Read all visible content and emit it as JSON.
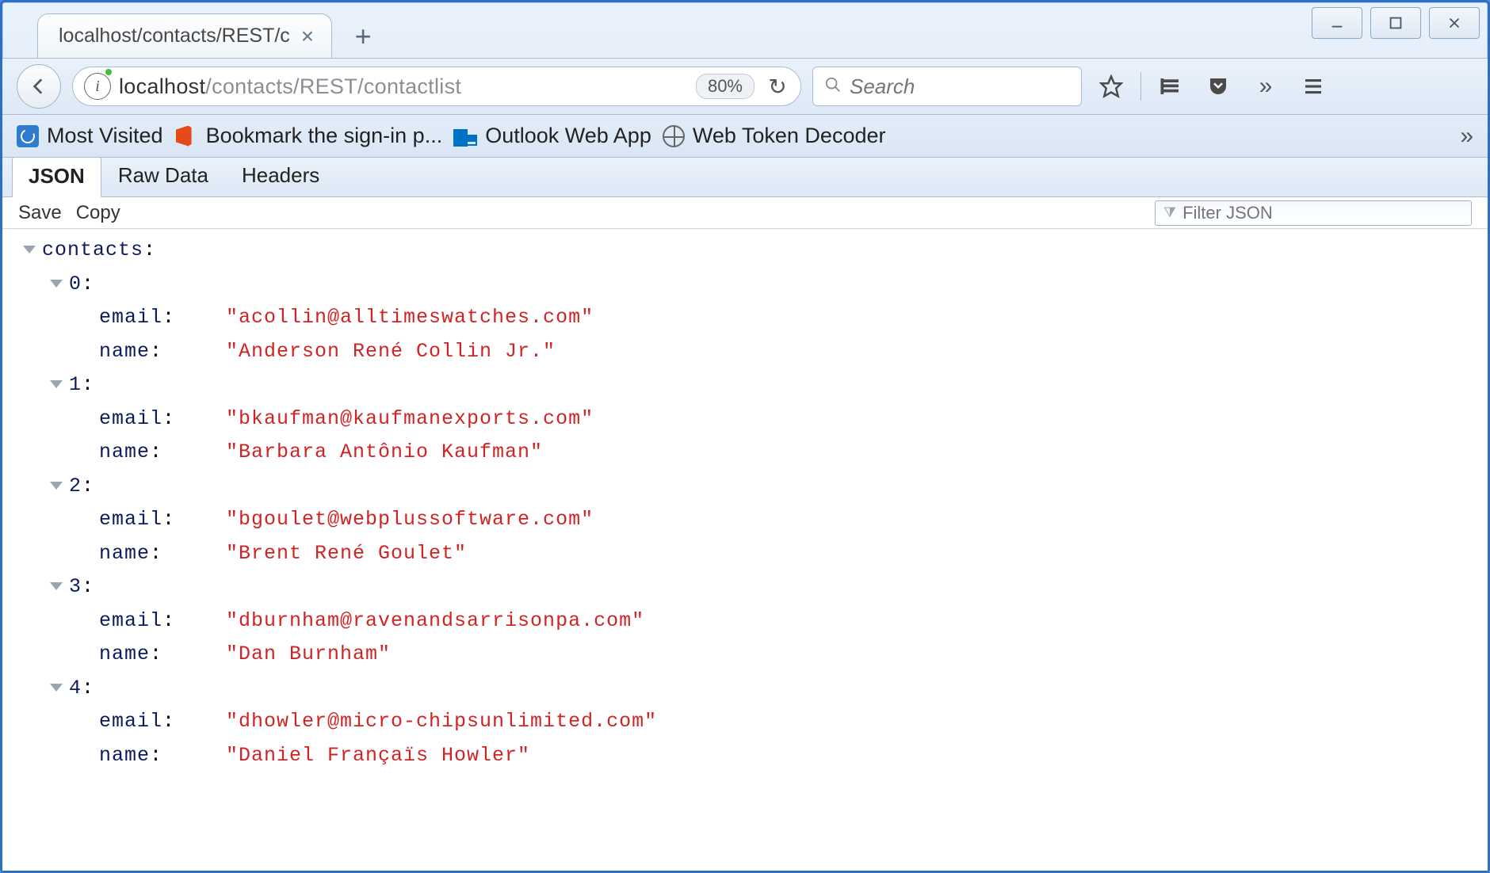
{
  "window": {
    "tab_title": "localhost/contacts/REST/c",
    "url_host": "localhost",
    "url_path": "/contacts/REST/contactlist",
    "zoom": "80%",
    "search_placeholder": "Search"
  },
  "bookmarks": {
    "most_visited": "Most Visited",
    "o365": "Bookmark the sign-in p...",
    "outlook": "Outlook Web App",
    "web_token_decoder": "Web Token Decoder"
  },
  "viewer_tabs": {
    "json": "JSON",
    "raw": "Raw Data",
    "headers": "Headers"
  },
  "actions": {
    "save": "Save",
    "copy": "Copy",
    "filter_placeholder": "Filter JSON"
  },
  "json": {
    "root_key": "contacts",
    "contacts": [
      {
        "email": "\"acollin@alltimeswatches.com\"",
        "name": "\"Anderson René Collin Jr.\""
      },
      {
        "email": "\"bkaufman@kaufmanexports.com\"",
        "name": "\"Barbara Antônio Kaufman\""
      },
      {
        "email": "\"bgoulet@webplussoftware.com\"",
        "name": "\"Brent René Goulet\""
      },
      {
        "email": "\"dburnham@ravenandsarrisonpa.com\"",
        "name": "\"Dan Burnham\""
      },
      {
        "email": "\"dhowler@micro-chipsunlimited.com\"",
        "name": "\"Daniel Françaïs Howler\""
      }
    ]
  }
}
